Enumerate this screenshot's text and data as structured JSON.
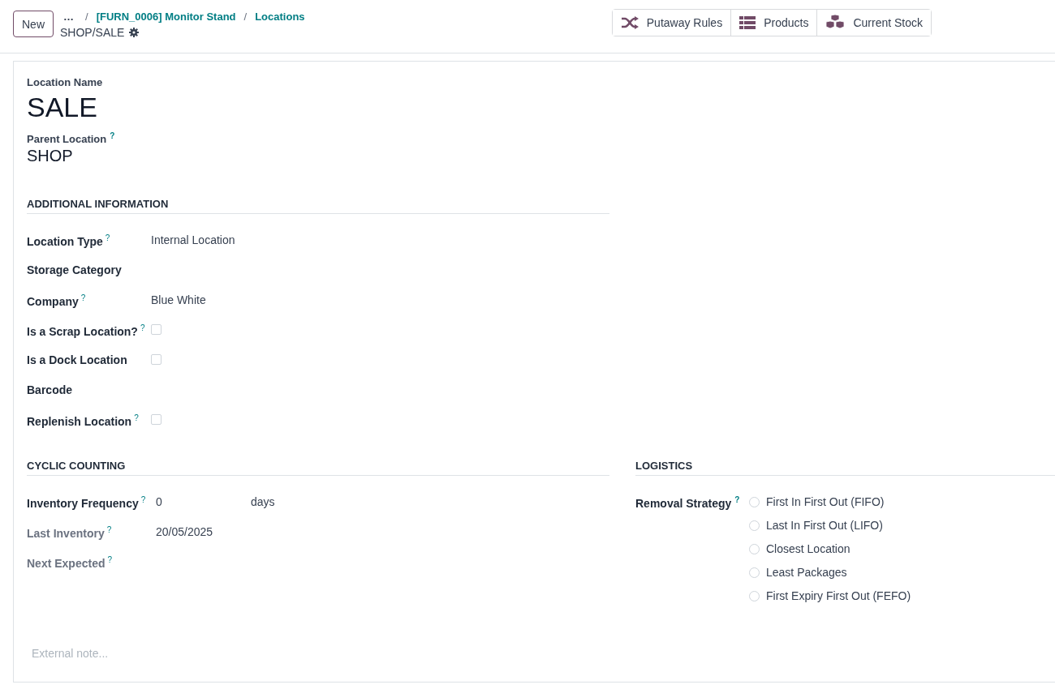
{
  "control_panel": {
    "new_button": "New",
    "more": "…",
    "breadcrumbs": [
      {
        "separator": "/",
        "label": "[FURN_0006] Monitor Stand"
      },
      {
        "separator": "/",
        "label": "Locations"
      }
    ],
    "record_title": "SHOP/SALE",
    "smart_buttons": [
      {
        "kind": "shuffle",
        "label": "Putaway Rules"
      },
      {
        "kind": "list",
        "label": "Products"
      },
      {
        "kind": "boxes",
        "label": "Current Stock"
      }
    ]
  },
  "form": {
    "name_label": "Location Name",
    "name": "SALE",
    "parent_label": "Parent Location",
    "parent_help": "?",
    "parent": "SHOP",
    "additional": {
      "title": "ADDITIONAL INFORMATION",
      "fields": [
        {
          "kind": "text",
          "label": "Location Type",
          "help": "?",
          "value": "Internal Location"
        },
        {
          "kind": "empty",
          "label": "Storage Category"
        },
        {
          "kind": "text",
          "label": "Company",
          "help": "?",
          "value": "Blue White"
        },
        {
          "kind": "checkbox",
          "label": "Is a Scrap Location?",
          "help": "?",
          "checked": false
        },
        {
          "kind": "checkbox",
          "label": "Is a Dock Location",
          "checked": false
        },
        {
          "kind": "empty",
          "label": "Barcode"
        },
        {
          "kind": "checkbox",
          "label": "Replenish Location",
          "help": "?",
          "checked": false
        }
      ]
    },
    "cyclic": {
      "title": "CYCLIC COUNTING",
      "fields": [
        {
          "kind": "number",
          "label": "Inventory Frequency",
          "help": "?",
          "value": "0",
          "unit": "days",
          "readonly": false
        },
        {
          "kind": "text",
          "label": "Last Inventory",
          "help": "?",
          "value": "20/05/2025",
          "readonly": true
        },
        {
          "kind": "empty",
          "label": "Next Expected",
          "help": "?",
          "readonly": true
        }
      ]
    },
    "logistics": {
      "title": "LOGISTICS",
      "label": "Removal Strategy",
      "help": "?",
      "options": [
        {
          "label": "First In First Out (FIFO)",
          "selected": false
        },
        {
          "label": "Last In First Out (LIFO)",
          "selected": false
        },
        {
          "label": "Closest Location",
          "selected": false
        },
        {
          "label": "Least Packages",
          "selected": false
        },
        {
          "label": "First Expiry First Out (FEFO)",
          "selected": false
        }
      ]
    },
    "note_placeholder": "External note..."
  }
}
